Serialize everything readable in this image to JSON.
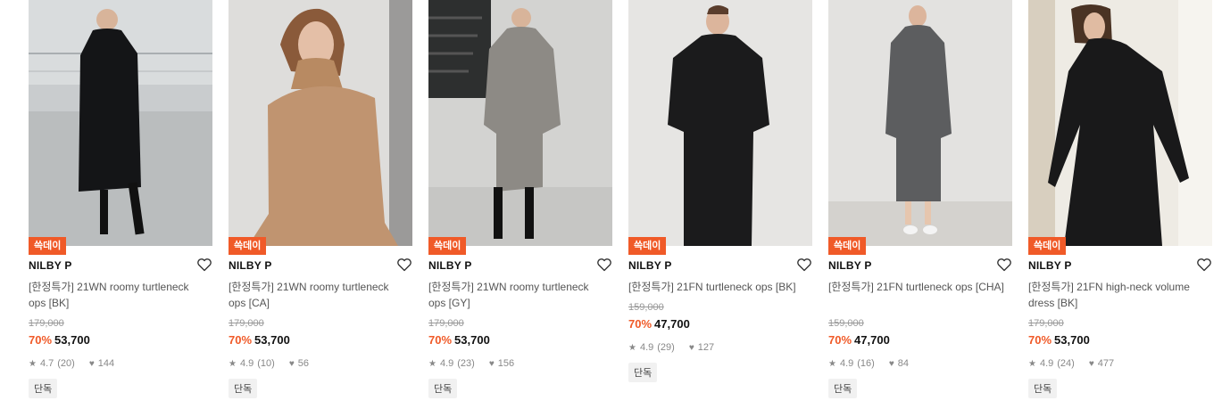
{
  "products": [
    {
      "tag": "쓱데이",
      "brand": "NILBY P",
      "name": "[한정특가] 21WN roomy turtleneck ops [BK]",
      "original_price": "179,000",
      "discount": "70%",
      "price": "53,700",
      "rating": "4.7",
      "reviews": "(20)",
      "likes": "144",
      "badge": "단독"
    },
    {
      "tag": "쓱데이",
      "brand": "NILBY P",
      "name": "[한정특가] 21WN roomy turtleneck ops [CA]",
      "original_price": "179,000",
      "discount": "70%",
      "price": "53,700",
      "rating": "4.9",
      "reviews": "(10)",
      "likes": "56",
      "badge": "단독"
    },
    {
      "tag": "쓱데이",
      "brand": "NILBY P",
      "name": "[한정특가] 21WN roomy turtleneck ops [GY]",
      "original_price": "179,000",
      "discount": "70%",
      "price": "53,700",
      "rating": "4.9",
      "reviews": "(23)",
      "likes": "156",
      "badge": "단독"
    },
    {
      "tag": "쓱데이",
      "brand": "NILBY P",
      "name": "[한정특가] 21FN turtleneck ops [BK]",
      "original_price": "159,000",
      "discount": "70%",
      "price": "47,700",
      "rating": "4.9",
      "reviews": "(29)",
      "likes": "127",
      "badge": "단독"
    },
    {
      "tag": "쓱데이",
      "brand": "NILBY P",
      "name": "[한정특가] 21FN turtleneck ops [CHA]",
      "original_price": "159,000",
      "discount": "70%",
      "price": "47,700",
      "rating": "4.9",
      "reviews": "(16)",
      "likes": "84",
      "badge": "단독"
    },
    {
      "tag": "쓱데이",
      "brand": "NILBY P",
      "name": "[한정특가] 21FN high-neck volume dress [BK]",
      "original_price": "179,000",
      "discount": "70%",
      "price": "53,700",
      "rating": "4.9",
      "reviews": "(24)",
      "likes": "477",
      "badge": "단독"
    }
  ],
  "colors": {
    "accent": "#f05a28",
    "badge_bg": "#f1f1f1"
  }
}
